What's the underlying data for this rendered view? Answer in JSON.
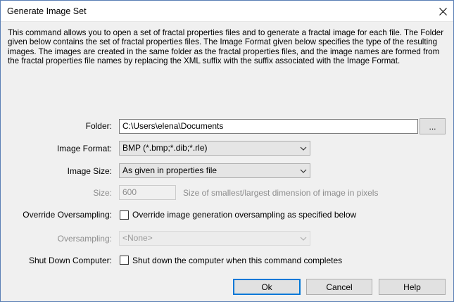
{
  "window": {
    "title": "Generate Image Set"
  },
  "description": "This command allows you to open a set of fractal properties files and to generate a fractal image for each file. The Folder given below contains the set of fractal properties files. The Image Format given below specifies the type of the resulting images. The images are created in the same folder as the fractal properties files, and the image names are formed from the fractal properties file names by replacing the XML suffix with the suffix associated with the Image Format.",
  "form": {
    "folder_label": "Folder:",
    "folder_value": "C:\\Users\\elena\\Documents",
    "browse_label": "...",
    "image_format_label": "Image Format:",
    "image_format_value": "BMP (*.bmp;*.dib;*.rle)",
    "image_size_label": "Image Size:",
    "image_size_value": "As given in properties file",
    "size_label": "Size:",
    "size_value": "600",
    "size_hint": "Size of smallest/largest dimension of image in pixels",
    "override_label": "Override Oversampling:",
    "override_checkbox_label": "Override image generation oversampling as specified below",
    "oversampling_label": "Oversampling:",
    "oversampling_value": "<None>",
    "shutdown_label": "Shut Down Computer:",
    "shutdown_checkbox_label": "Shut down the computer when this command completes"
  },
  "buttons": {
    "ok": "Ok",
    "cancel": "Cancel",
    "help": "Help"
  }
}
